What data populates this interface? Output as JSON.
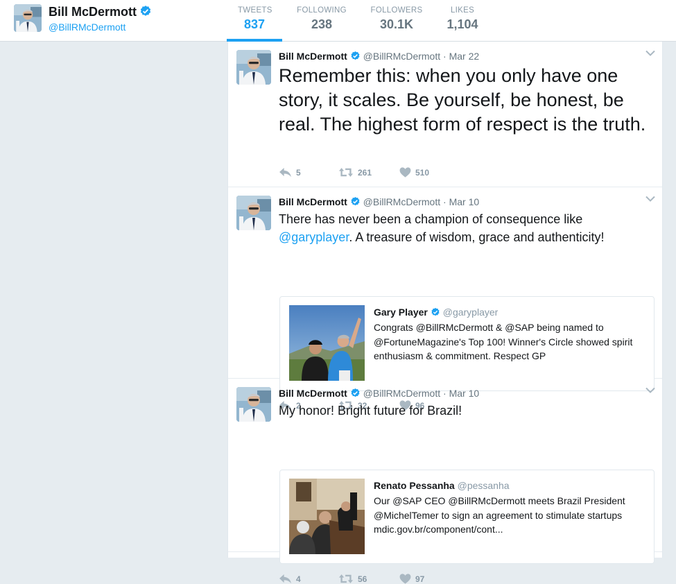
{
  "profile": {
    "name": "Bill McDermott",
    "handle": "@BillRMcDermott"
  },
  "stats": [
    {
      "label": "TWEETS",
      "value": "837"
    },
    {
      "label": "FOLLOWING",
      "value": "238"
    },
    {
      "label": "FOLLOWERS",
      "value": "30.1K"
    },
    {
      "label": "LIKES",
      "value": "1,104"
    }
  ],
  "tweets": [
    {
      "name": "Bill McDermott",
      "handle": "@BillRMcDermott",
      "sep": "·",
      "date": "Mar 22",
      "text": "Remember this: when you only have one story, it scales. Be yourself, be honest, be real. The highest form of respect is the truth.",
      "replies": "5",
      "retweets": "261",
      "likes": "510"
    },
    {
      "name": "Bill McDermott",
      "handle": "@BillRMcDermott",
      "sep": "·",
      "date": "Mar 10",
      "text_before": "There has never been a champion of consequence like ",
      "mention": "@garyplayer",
      "text_after": ". A treasure of wisdom, grace and authenticity!",
      "quote": {
        "name": "Gary Player",
        "handle": "@garyplayer",
        "text": "Congrats @BillRMcDermott & @SAP being named to @FortuneMagazine's Top 100! Winner's Circle showed spirit enthusiasm & commitment. Respect GP"
      },
      "replies": "2",
      "retweets": "32",
      "likes": "96"
    },
    {
      "name": "Bill McDermott",
      "handle": "@BillRMcDermott",
      "sep": "·",
      "date": "Mar 10",
      "text": "My honor! Bright future for Brazil!",
      "quote": {
        "name": "Renato Pessanha",
        "handle": "@pessanha",
        "text": "Our @SAP CEO @BillRMcDermott meets Brazil President @MichelTemer to sign an agreement to stimulate startups mdic.gov.br/component/cont..."
      },
      "replies": "4",
      "retweets": "56",
      "likes": "97"
    }
  ],
  "colors": {
    "accent": "#1da1f2",
    "background": "#e6ecf0",
    "muted": "#8899a6"
  },
  "icons": [
    "verified-icon",
    "reply-icon",
    "retweet-icon",
    "heart-icon",
    "chevron-down-icon"
  ]
}
